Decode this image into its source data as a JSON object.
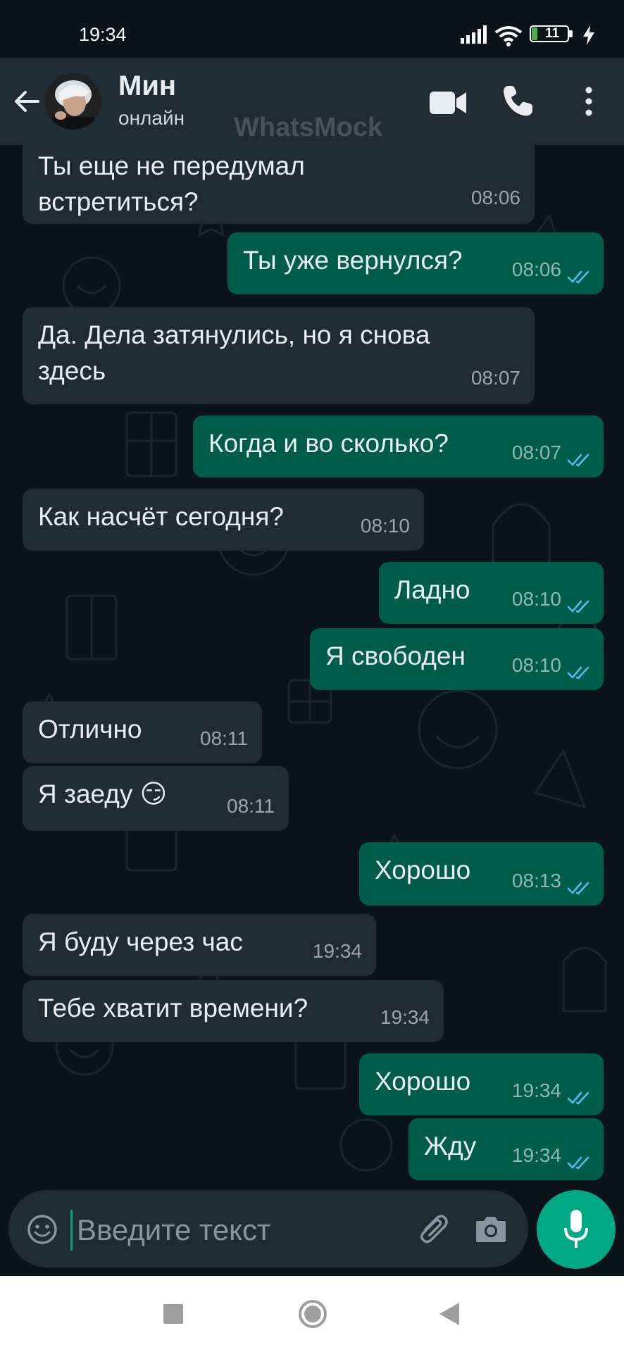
{
  "status_bar": {
    "time": "19:34",
    "battery_level": "11",
    "icons": [
      "signal-icon",
      "wifi-icon",
      "battery-icon",
      "charging-icon"
    ]
  },
  "header": {
    "contact_name": "Мин",
    "contact_status": "онлайн",
    "watermark": "WhatsMock",
    "icons": [
      "back-arrow-icon",
      "video-call-icon",
      "phone-call-icon",
      "more-options-icon"
    ]
  },
  "messages": [
    {
      "dir": "in",
      "text": "Ты еще не передумал\nвстретиться?",
      "time": "08:06"
    },
    {
      "dir": "out",
      "text": "Ты уже вернулся?",
      "time": "08:06",
      "read": true
    },
    {
      "dir": "in",
      "text": "Да. Дела затянулись, но я снова\nздесь",
      "time": "08:07"
    },
    {
      "dir": "out",
      "text": "Когда и во сколько?",
      "time": "08:07",
      "read": true
    },
    {
      "dir": "in",
      "text": "Как насчёт сегодня?",
      "time": "08:10"
    },
    {
      "dir": "out",
      "text": "Ладно",
      "time": "08:10",
      "read": true
    },
    {
      "dir": "out",
      "text": "Я свободен",
      "time": "08:10",
      "read": true
    },
    {
      "dir": "in",
      "text": "Отлично",
      "time": "08:11"
    },
    {
      "dir": "in",
      "text": "Я заеду 😏",
      "time": "08:11"
    },
    {
      "dir": "out",
      "text": "Хорошо",
      "time": "08:13",
      "read": true
    },
    {
      "dir": "in",
      "text": "Я буду через час",
      "time": "19:34"
    },
    {
      "dir": "in",
      "text": "Тебе хватит времени?",
      "time": "19:34"
    },
    {
      "dir": "out",
      "text": "Хорошо",
      "time": "19:34",
      "read": true
    },
    {
      "dir": "out",
      "text": "Жду",
      "time": "19:34",
      "read": true
    }
  ],
  "input": {
    "placeholder": "Введите текст",
    "icons": [
      "emoji-icon",
      "attach-icon",
      "camera-icon",
      "microphone-icon"
    ]
  },
  "colors": {
    "background": "#0b141a",
    "header": "#1f2c34",
    "incoming_bubble": "#202c33",
    "outgoing_bubble": "#005c4b",
    "read_ticks": "#53bdeb",
    "accent": "#00a884"
  }
}
